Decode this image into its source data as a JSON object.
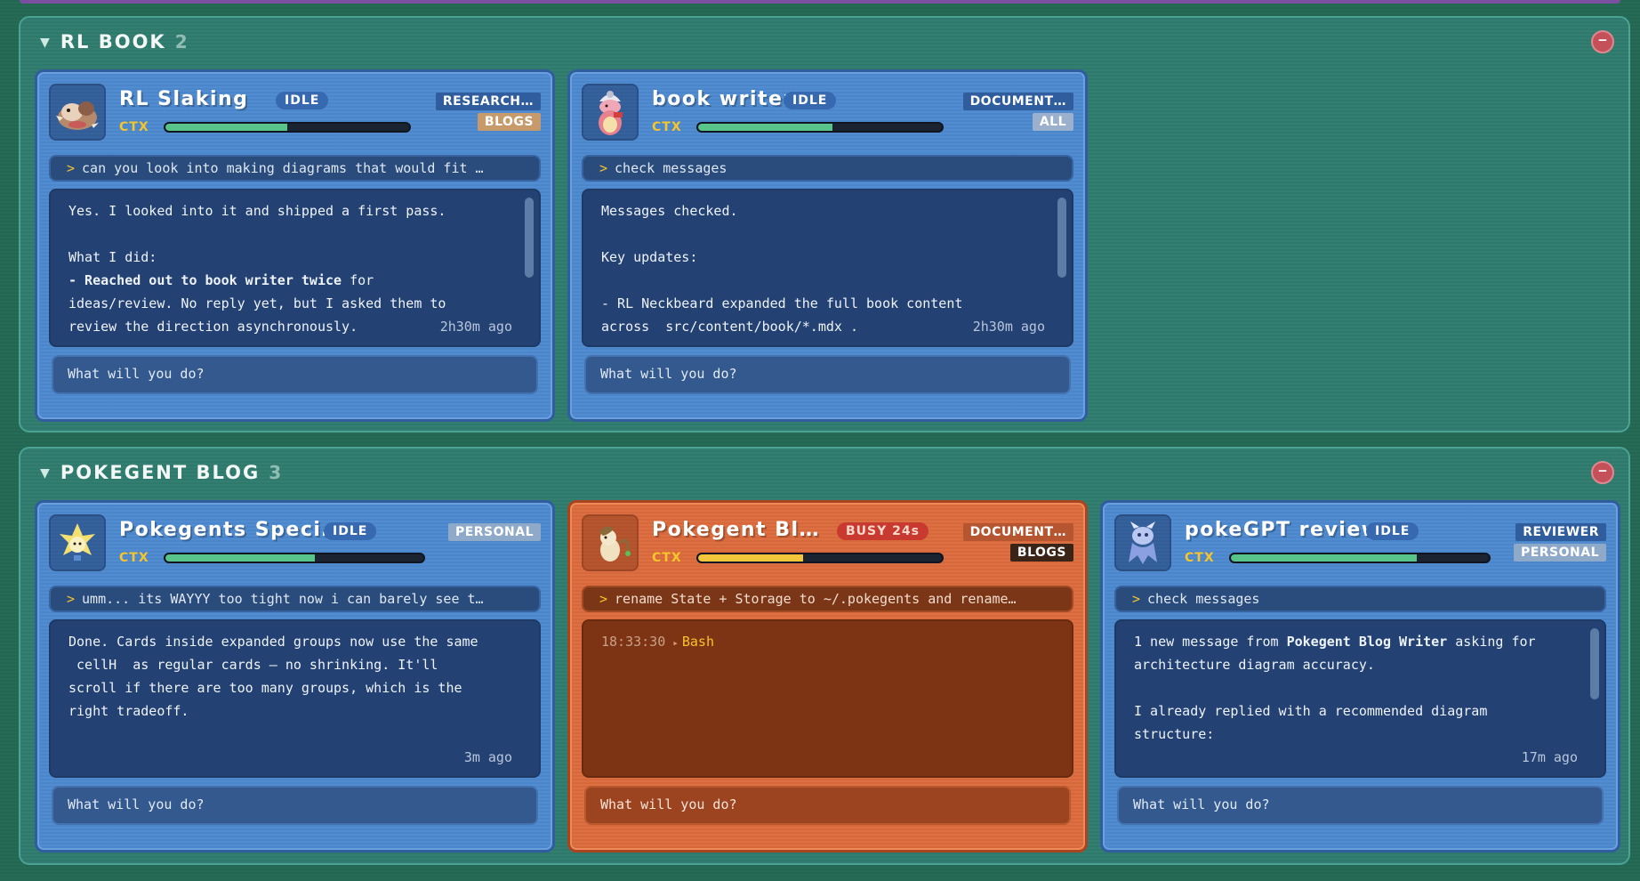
{
  "groups": [
    {
      "title": "RL BOOK",
      "count": "2",
      "cards": [
        {
          "name": "RL Slaking",
          "status": "IDLE",
          "tags": [
            "RESEARCH…",
            "BLOGS"
          ],
          "ctx_label": "CTX",
          "ctx_fill": 0.5,
          "prompt": "can you look into making diagrams that would fit …",
          "output_lines": [
            "Yes. I looked into it and shipped a first pass.",
            "",
            "What I did:"
          ],
          "output_bold": "- Reached out to book writer twice",
          "output_after_bold": " for",
          "output_tail": [
            "ideas/review. No reply yet, but I asked them to",
            "review the direction asynchronously."
          ],
          "ago": "2h30m ago",
          "input_placeholder": "What will you do?"
        },
        {
          "name": "book writer",
          "status": "IDLE",
          "tags": [
            "DOCUMENT…",
            "ALL"
          ],
          "ctx_label": "CTX",
          "ctx_fill": 0.55,
          "prompt": "check messages",
          "output_lines": [
            "Messages checked.",
            "",
            "Key updates:",
            "",
            "- RL Neckbeard expanded the full book content",
            "across  src/content/book/*.mdx ."
          ],
          "ago": "2h30m ago",
          "input_placeholder": "What will you do?"
        }
      ]
    },
    {
      "title": "POKEGENT BLOG",
      "count": "3",
      "cards": [
        {
          "name": "Pokegents Speci…",
          "status": "IDLE",
          "tags": [
            "PERSONAL"
          ],
          "ctx_label": "CTX",
          "ctx_fill": 0.58,
          "prompt": "umm... its WAYYY too tight now i can barely see t…",
          "output_lines": [
            "Done. Cards inside expanded groups now use the same",
            " cellH  as regular cards — no shrinking. It'll",
            "scroll if there are too many groups, which is the",
            "right tradeoff."
          ],
          "ago": "3m ago",
          "input_placeholder": "What will you do?"
        },
        {
          "name": "Pokegent Bl…",
          "status": "BUSY 24s",
          "tags": [
            "DOCUMENT…",
            "BLOGS"
          ],
          "ctx_label": "CTX",
          "ctx_fill": 0.43,
          "prompt": "rename State + Storage to ~/.pokegents and rename…",
          "tool_time": "18:33:30",
          "tool_name": "Bash",
          "input_placeholder": "What will you do?"
        },
        {
          "name": "pokeGPT reviewer",
          "status": "IDLE",
          "tags": [
            "REVIEWER",
            "PERSONAL"
          ],
          "ctx_label": "CTX",
          "ctx_fill": 0.72,
          "prompt": "check messages",
          "output_pre": "1 new message from ",
          "output_bold": "Pokegent Blog Writer",
          "output_post": " asking for",
          "output_lines": [
            "architecture diagram accuracy.",
            "",
            "I already replied with a recommended diagram",
            "structure:"
          ],
          "ago": "17m ago",
          "input_placeholder": "What will you do?"
        }
      ]
    }
  ],
  "colors": {
    "accent_ctx": "#f5c52a",
    "bar_green": "#58c48a",
    "bar_yellow": "#f3c53a",
    "card_blue": "#4a86cc",
    "card_orange": "#d8683a",
    "busy_red": "#c83a30"
  },
  "icons": [
    "collapse-triangle-icon",
    "minimize-group-icon",
    "prompt-chevron-icon",
    "tool-arrow-icon"
  ],
  "tool_arrow": "▸",
  "chevron": ">",
  "triangle": "▼",
  "minus": "–"
}
